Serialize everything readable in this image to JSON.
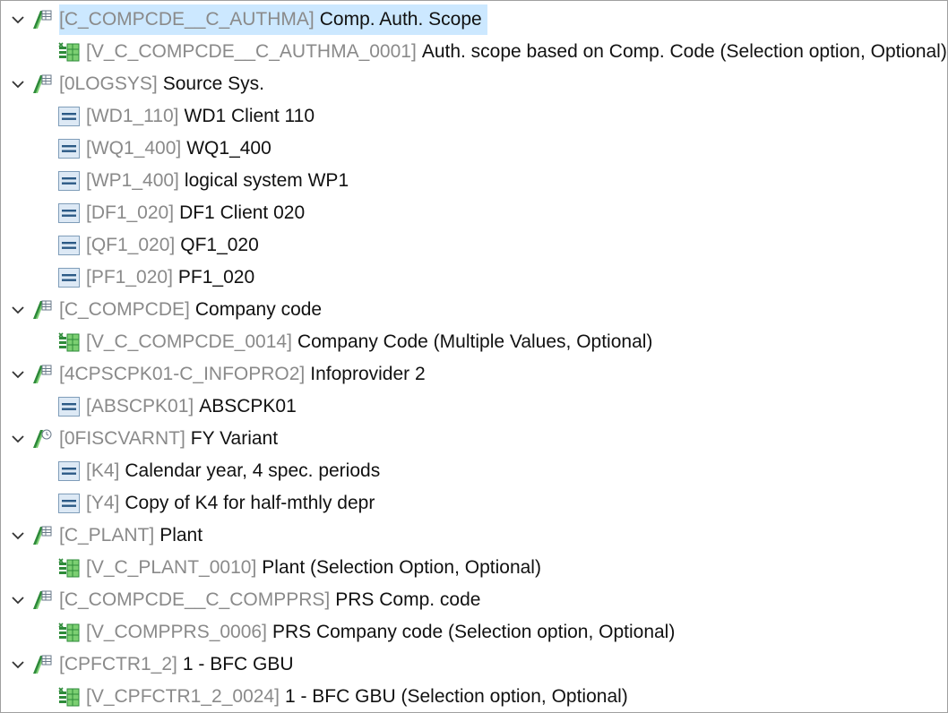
{
  "tree": {
    "nodes": [
      {
        "level": 0,
        "expanded": true,
        "icon": "characteristic-icon",
        "tech": "[C_COMPCDE__C_AUTHMA]",
        "text": "Comp. Auth. Scope",
        "selected": true
      },
      {
        "level": 1,
        "icon": "variable-icon",
        "tech": "[V_C_COMPCDE__C_AUTHMA_0001]",
        "text": "Auth. scope based on Comp. Code (Selection option, Optional)"
      },
      {
        "level": 0,
        "expanded": true,
        "icon": "characteristic-icon",
        "tech": "[0LOGSYS]",
        "text": "Source Sys."
      },
      {
        "level": 1,
        "icon": "value-icon",
        "tech": "[WD1_110]",
        "text": "WD1 Client 110"
      },
      {
        "level": 1,
        "icon": "value-icon",
        "tech": "[WQ1_400]",
        "text": "WQ1_400"
      },
      {
        "level": 1,
        "icon": "value-icon",
        "tech": "[WP1_400]",
        "text": "logical system WP1"
      },
      {
        "level": 1,
        "icon": "value-icon",
        "tech": "[DF1_020]",
        "text": "DF1 Client 020"
      },
      {
        "level": 1,
        "icon": "value-icon",
        "tech": "[QF1_020]",
        "text": "QF1_020"
      },
      {
        "level": 1,
        "icon": "value-icon",
        "tech": "[PF1_020]",
        "text": "PF1_020"
      },
      {
        "level": 0,
        "expanded": true,
        "icon": "characteristic-icon",
        "tech": "[C_COMPCDE]",
        "text": "Company code"
      },
      {
        "level": 1,
        "icon": "variable-icon",
        "tech": "[V_C_COMPCDE_0014]",
        "text": "Company Code (Multiple Values, Optional)"
      },
      {
        "level": 0,
        "expanded": true,
        "icon": "characteristic-icon",
        "tech": "[4CPSCPK01-C_INFOPRO2]",
        "text": "Infoprovider 2"
      },
      {
        "level": 1,
        "icon": "value-icon",
        "tech": "[ABSCPK01]",
        "text": "ABSCPK01"
      },
      {
        "level": 0,
        "expanded": true,
        "icon": "time-characteristic-icon",
        "tech": "[0FISCVARNT]",
        "text": "FY Variant"
      },
      {
        "level": 1,
        "icon": "value-icon",
        "tech": "[K4]",
        "text": "Calendar year, 4 spec. periods"
      },
      {
        "level": 1,
        "icon": "value-icon",
        "tech": "[Y4]",
        "text": "Copy of K4 for half-mthly depr"
      },
      {
        "level": 0,
        "expanded": true,
        "icon": "characteristic-icon",
        "tech": "[C_PLANT]",
        "text": "Plant"
      },
      {
        "level": 1,
        "icon": "variable-icon",
        "tech": "[V_C_PLANT_0010]",
        "text": "Plant (Selection Option, Optional)"
      },
      {
        "level": 0,
        "expanded": true,
        "icon": "characteristic-icon",
        "tech": "[C_COMPCDE__C_COMPPRS]",
        "text": "PRS Comp. code"
      },
      {
        "level": 1,
        "icon": "variable-icon",
        "tech": "[V_COMPPRS_0006]",
        "text": "PRS Company code (Selection option, Optional)"
      },
      {
        "level": 0,
        "expanded": true,
        "icon": "characteristic-icon",
        "tech": "[CPFCTR1_2]",
        "text": "1 - BFC GBU"
      },
      {
        "level": 1,
        "icon": "variable-icon",
        "tech": "[V_CPFCTR1_2_0024]",
        "text": "1 - BFC GBU (Selection option, Optional)"
      }
    ]
  }
}
